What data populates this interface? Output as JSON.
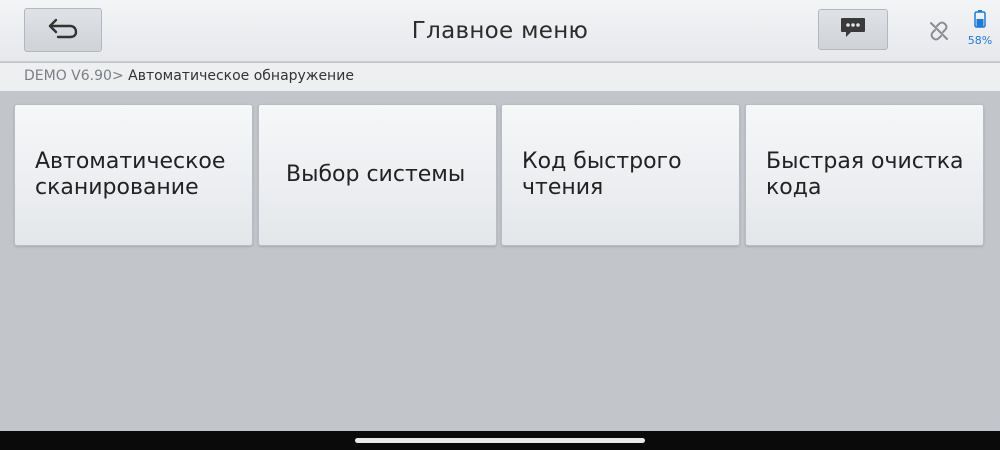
{
  "header": {
    "title": "Главное меню",
    "battery_percent": "58%",
    "battery_level": 0.58
  },
  "breadcrumb": {
    "version": "DEMO V6.90",
    "separator": ">",
    "current": " Автоматическое обнаружение"
  },
  "tiles": [
    {
      "label": "Автоматическое сканирование"
    },
    {
      "label": "Выбор системы"
    },
    {
      "label": "Код быстрого чтения"
    },
    {
      "label": "Быстрая очистка кода"
    }
  ],
  "icons": {
    "back": "back-arrow-icon",
    "message": "message-icon",
    "connection": "link-broken-icon",
    "battery": "battery-icon"
  },
  "colors": {
    "accent": "#1e7ad6",
    "background": "#c2c5ca",
    "tile": "#eef0f2"
  }
}
